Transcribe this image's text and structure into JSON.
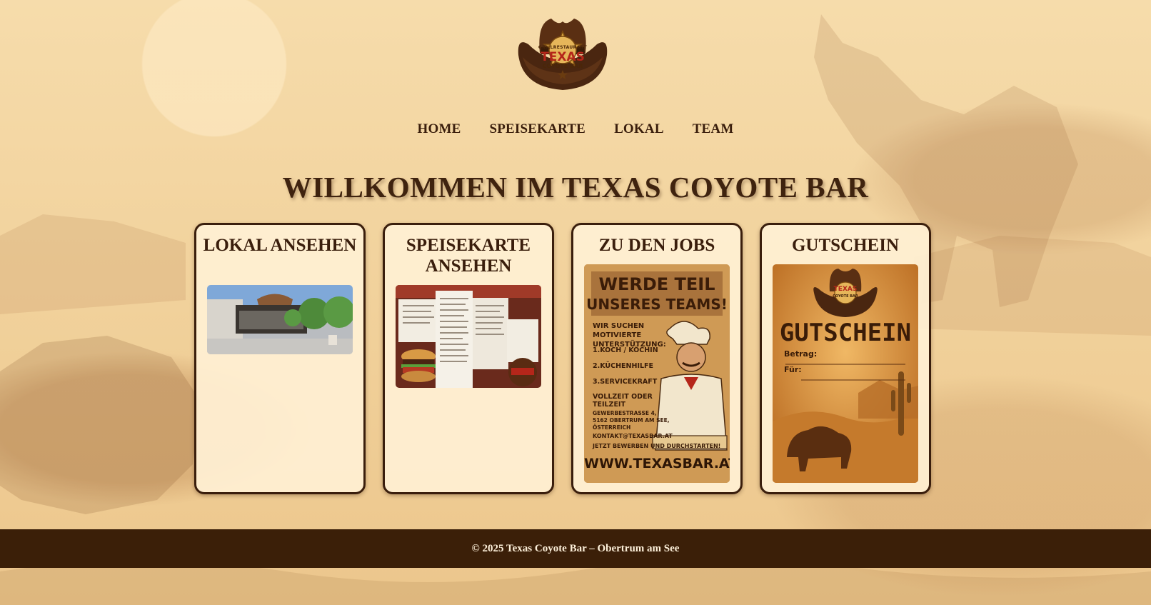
{
  "logo": {
    "icon": "cowboy-hat-sheriff-star-icon",
    "small_text": "GRILLRESTAURANT",
    "main_text": "TEXAS",
    "sub_text": "COYOTE BAR"
  },
  "nav": {
    "items": [
      "HOME",
      "SPEISEKARTE",
      "LOKAL",
      "TEAM"
    ]
  },
  "hero": {
    "title": "WILLKOMMEN IM TEXAS COYOTE BAR"
  },
  "cards": [
    {
      "title": "LOKAL ANSEHEN",
      "image": "restaurant-exterior-photo"
    },
    {
      "title": "SPEISEKARTE ANSEHEN",
      "image": "menu-collage-photo"
    },
    {
      "title": "ZU DEN JOBS",
      "image": "job-poster",
      "poster": {
        "headline_1": "WERDE TEIL",
        "headline_2": "UNSERES TEAMS!",
        "intro": "WIR SUCHEN MOTIVIERTE UNTERSTÜTZUNG:",
        "roles": [
          "1.KOCH / KÖCHIN",
          "2.KÜCHENHILFE",
          "3.SERVICEKRAFT",
          "VOLLZEIT ODER TEILZEIT"
        ],
        "address": [
          "GEWERBESTRASSE 4,",
          "5162 OBERTRUM AM SEE,",
          "ÖSTERREICH"
        ],
        "email": "KONTAKT@TEXASBAR.AT",
        "cta": "JETZT BEWERBEN UND DURCHSTARTEN!",
        "url": "WWW.TEXASBAR.AT"
      }
    },
    {
      "title": "GUTSCHEIN",
      "image": "voucher-poster",
      "voucher": {
        "logo_main": "TEXAS",
        "logo_sub": "COYOTE BAR",
        "headline": "GUTSCHEIN",
        "field_1": "Betrag:",
        "field_2": "Für:"
      }
    }
  ],
  "footer": {
    "text": "© 2025 Texas Coyote Bar – Obertrum am See"
  },
  "colors": {
    "background": "#f3d6a5",
    "dark_brown": "#3b1f08",
    "card_bg": "#fff0d4",
    "accent_red": "#b5261a"
  }
}
